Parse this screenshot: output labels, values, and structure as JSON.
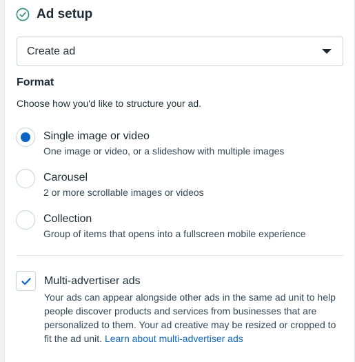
{
  "header": {
    "title": "Ad setup",
    "status_icon": "check-circle-icon"
  },
  "ad_select": {
    "value": "Create ad",
    "icon": "caret-down-icon"
  },
  "format": {
    "title": "Format",
    "description": "Choose how you'd like to structure your ad.",
    "options": [
      {
        "label": "Single image or video",
        "description": "One image or video, or a slideshow with multiple images",
        "selected": true
      },
      {
        "label": "Carousel",
        "description": "2 or more scrollable images or videos",
        "selected": false
      },
      {
        "label": "Collection",
        "description": "Group of items that opens into a fullscreen mobile experience",
        "selected": false
      }
    ]
  },
  "multi_advertiser": {
    "label": "Multi-advertiser ads",
    "checked": true,
    "description": "Your ads can appear alongside other ads in the same ad unit to help people discover products and services from businesses that are personalized to them. Your ad creative may be resized or cropped to fit the ad unit.",
    "link_text": "Learn about multi-advertiser ads"
  },
  "colors": {
    "accent": "#0a66c2",
    "check_green": "#2e8f74",
    "text": "#1c2b33"
  }
}
